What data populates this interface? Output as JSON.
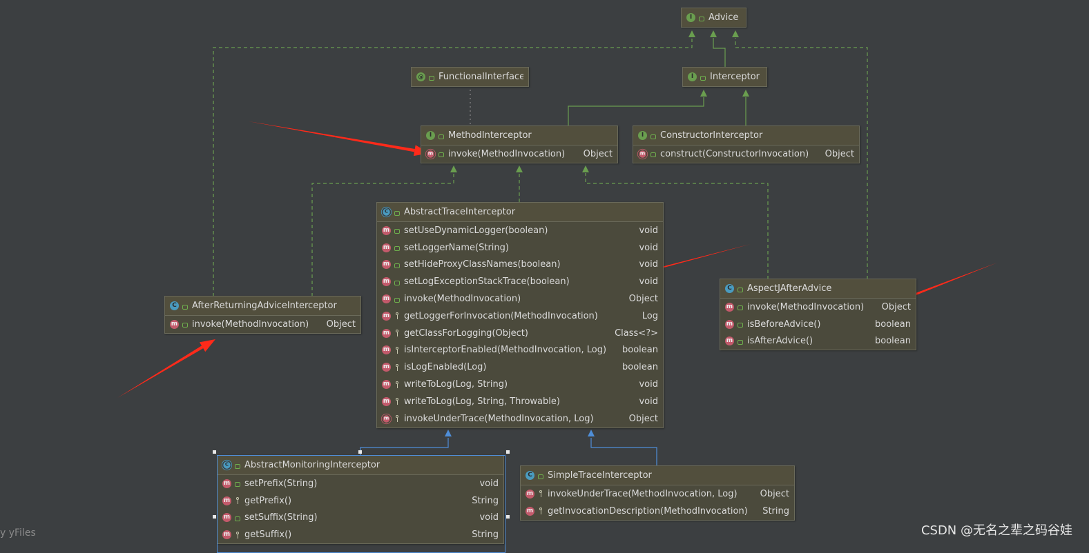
{
  "nodes": {
    "advice": {
      "title": "Advice",
      "kind": "interface"
    },
    "functional_interface": {
      "title": "FunctionalInterface",
      "kind": "annotation"
    },
    "interceptor": {
      "title": "Interceptor",
      "kind": "interface"
    },
    "method_interceptor": {
      "title": "MethodInterceptor",
      "kind": "interface",
      "methods": [
        {
          "name": "invoke(MethodInvocation)",
          "type": "Object",
          "icon": "abstract-method",
          "vis": "public"
        }
      ]
    },
    "constructor_interceptor": {
      "title": "ConstructorInterceptor",
      "kind": "interface",
      "methods": [
        {
          "name": "construct(ConstructorInvocation)",
          "type": "Object",
          "icon": "abstract-method",
          "vis": "public"
        }
      ]
    },
    "abstract_trace_interceptor": {
      "title": "AbstractTraceInterceptor",
      "kind": "abstract-class",
      "methods": [
        {
          "name": "setUseDynamicLogger(boolean)",
          "type": "void",
          "icon": "method",
          "vis": "public"
        },
        {
          "name": "setLoggerName(String)",
          "type": "void",
          "icon": "method",
          "vis": "public"
        },
        {
          "name": "setHideProxyClassNames(boolean)",
          "type": "void",
          "icon": "method",
          "vis": "public"
        },
        {
          "name": "setLogExceptionStackTrace(boolean)",
          "type": "void",
          "icon": "method",
          "vis": "public"
        },
        {
          "name": "invoke(MethodInvocation)",
          "type": "Object",
          "icon": "method",
          "vis": "public"
        },
        {
          "name": "getLoggerForInvocation(MethodInvocation)",
          "type": "Log",
          "icon": "method",
          "vis": "protected"
        },
        {
          "name": "getClassForLogging(Object)",
          "type": "Class<?>",
          "icon": "method",
          "vis": "protected"
        },
        {
          "name": "isInterceptorEnabled(MethodInvocation, Log)",
          "type": "boolean",
          "icon": "method",
          "vis": "protected"
        },
        {
          "name": "isLogEnabled(Log)",
          "type": "boolean",
          "icon": "method",
          "vis": "protected"
        },
        {
          "name": "writeToLog(Log, String)",
          "type": "void",
          "icon": "method",
          "vis": "protected"
        },
        {
          "name": "writeToLog(Log, String, Throwable)",
          "type": "void",
          "icon": "method",
          "vis": "protected"
        },
        {
          "name": "invokeUnderTrace(MethodInvocation, Log)",
          "type": "Object",
          "icon": "abstract-method",
          "vis": "protected"
        }
      ]
    },
    "after_returning_advice_interceptor": {
      "title": "AfterReturningAdviceInterceptor",
      "kind": "class",
      "methods": [
        {
          "name": "invoke(MethodInvocation)",
          "type": "Object",
          "icon": "method",
          "vis": "public"
        }
      ]
    },
    "aspectj_after_advice": {
      "title": "AspectJAfterAdvice",
      "kind": "class",
      "methods": [
        {
          "name": "invoke(MethodInvocation)",
          "type": "Object",
          "icon": "method",
          "vis": "public"
        },
        {
          "name": "isBeforeAdvice()",
          "type": "boolean",
          "icon": "method",
          "vis": "public"
        },
        {
          "name": "isAfterAdvice()",
          "type": "boolean",
          "icon": "method",
          "vis": "public"
        }
      ]
    },
    "abstract_monitoring_interceptor": {
      "title": "AbstractMonitoringInterceptor",
      "kind": "abstract-class",
      "methods": [
        {
          "name": "setPrefix(String)",
          "type": "void",
          "icon": "method",
          "vis": "public"
        },
        {
          "name": "getPrefix()",
          "type": "String",
          "icon": "method",
          "vis": "protected"
        },
        {
          "name": "setSuffix(String)",
          "type": "void",
          "icon": "method",
          "vis": "public"
        },
        {
          "name": "getSuffix()",
          "type": "String",
          "icon": "method",
          "vis": "protected"
        }
      ]
    },
    "simple_trace_interceptor": {
      "title": "SimpleTraceInterceptor",
      "kind": "class",
      "methods": [
        {
          "name": "invokeUnderTrace(MethodInvocation, Log)",
          "type": "Object",
          "icon": "method",
          "vis": "protected"
        },
        {
          "name": "getInvocationDescription(MethodInvocation)",
          "type": "String",
          "icon": "method",
          "vis": "protected"
        }
      ]
    }
  },
  "icon_letters": {
    "interface": "I",
    "class": "C",
    "abstract-class": "C",
    "annotation": "@",
    "method": "m",
    "abstract-method": "m"
  },
  "colors": {
    "background": "#3c3f41",
    "node_fill": "#4b4a3c",
    "realization": "#6a9e4f",
    "generalization": "#4f8ed8",
    "annotation_link": "#888888",
    "annotation_arrow": "#ff2a1a"
  },
  "footer": {
    "yfiles": "y yFiles",
    "watermark": "CSDN @无名之辈之码谷娃"
  }
}
